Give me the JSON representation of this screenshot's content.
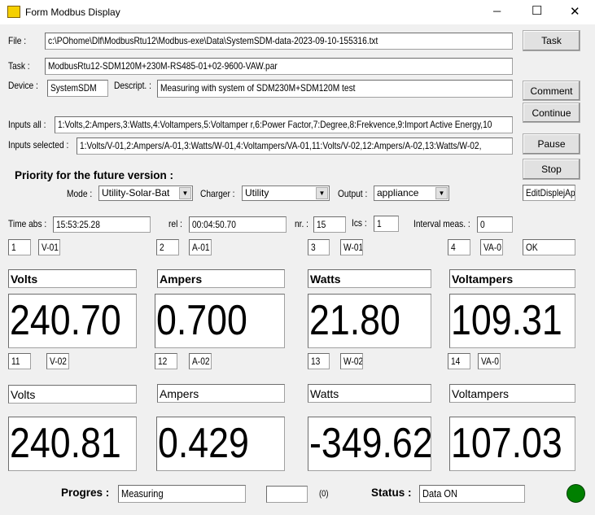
{
  "window": {
    "title": "Form Modbus Display",
    "min": "─",
    "max": "☐",
    "close": "✕"
  },
  "file": {
    "label": "File :",
    "value": "c:\\POhome\\Dlf\\ModbusRtu12\\Modbus-exe\\Data\\SystemSDM-data-2023-09-10-155316.txt"
  },
  "task": {
    "label": "Task :",
    "value": "ModbusRtu12-SDM120M+230M-RS485-01+02-9600-VAW.par"
  },
  "device": {
    "label": "Device :",
    "value": "SystemSDM"
  },
  "descript": {
    "label": "Descript. :",
    "value": "Measuring with system of SDM230M+SDM120M test"
  },
  "inputs_all": {
    "label": "Inputs all :",
    "value": "1:Volts,2:Ampers,3:Watts,4:Voltampers,5:Voltamper r,6:Power Factor,7:Degree,8:Frekvence,9:Import Active Energy,10"
  },
  "inputs_selected": {
    "label": "Inputs selected :",
    "value": "1:Volts/V-01,2:Ampers/A-01,3:Watts/W-01,4:Voltampers/VA-01,11:Volts/V-02,12:Ampers/A-02,13:Watts/W-02,"
  },
  "buttons": {
    "task": "Task",
    "comment": "Comment",
    "continue": "Continue",
    "pause": "Pause",
    "stop": "Stop"
  },
  "priority": {
    "title": "Priority for the future version  :",
    "mode_label": "Mode :",
    "mode": "Utility-Solar-Bat",
    "charger_label": "Charger :",
    "charger": "Utility",
    "output_label": "Output :",
    "output": "appliance",
    "edit": "EditDisplejAp"
  },
  "timing": {
    "abs_label": "Time abs :",
    "abs": "15:53:25.28",
    "rel_label": "rel :",
    "rel": "00:04:50.70",
    "nr_label": "nr. :",
    "nr": "15",
    "ics_label": "Ics :",
    "ics": "1",
    "interval_label": "Interval meas. :",
    "interval": "0"
  },
  "row1": [
    {
      "num": "1",
      "code": "V-01",
      "name": "Volts",
      "value": "240.70"
    },
    {
      "num": "2",
      "code": "A-01",
      "name": "Ampers",
      "value": "0.700"
    },
    {
      "num": "3",
      "code": "W-01",
      "name": "Watts",
      "value": "21.80"
    },
    {
      "num": "4",
      "code": "VA-0",
      "name": "Voltampers",
      "value": "109.31"
    }
  ],
  "row1_status": "OK",
  "row2": [
    {
      "num": "11",
      "code": "V-02",
      "name": "Volts",
      "value": "240.81"
    },
    {
      "num": "12",
      "code": "A-02",
      "name": "Ampers",
      "value": "0.429"
    },
    {
      "num": "13",
      "code": "W-02",
      "name": "Watts",
      "value": "-349.62"
    },
    {
      "num": "14",
      "code": "VA-0",
      "name": "Voltampers",
      "value": "107.03"
    }
  ],
  "footer": {
    "progress_label": "Progres :",
    "progress": "Measuring",
    "count_box": "",
    "count": "(0)",
    "status_label": "Status :",
    "status": "Data ON",
    "indicator_color": "#008000"
  }
}
